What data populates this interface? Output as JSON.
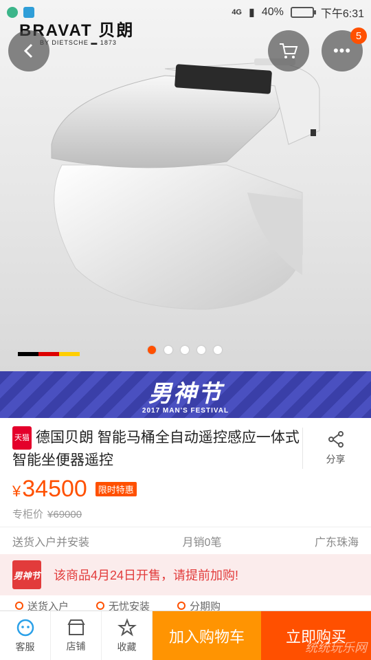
{
  "status": {
    "network": "4G",
    "battery": "40%",
    "battery_level": 0.4,
    "time": "下午6:31"
  },
  "hero": {
    "brand_name": "BRAVAT 贝朗",
    "brand_sub": "BY DIETSCHE ▬ 1873",
    "cart_badge": "5",
    "image_count": 5,
    "active_image": 1,
    "flag_colors": [
      "#000000",
      "#dd0000",
      "#ffce00"
    ]
  },
  "banner": {
    "title": "男神节",
    "subtitle": "2017 MAN'S FESTIVAL"
  },
  "product": {
    "store_tag": "天猫",
    "title": "德国贝朗 智能马桶全自动遥控感应一体式智能坐便器遥控",
    "share_label": "分享",
    "currency": "¥",
    "price": "34500",
    "promo_tag": "限时特惠",
    "orig_label": "专柜价",
    "orig_price": "¥69000"
  },
  "shipping": {
    "delivery": "送货入户并安装",
    "monthly_sales": "月销0笔",
    "location": "广东珠海"
  },
  "notice": {
    "logo_text": "男神节",
    "message": "该商品4月24日开售，请提前加购!"
  },
  "services": [
    "送货入户",
    "无忧安装",
    "分期购"
  ],
  "bottom": {
    "service_label": "客服",
    "store_label": "店铺",
    "fav_label": "收藏",
    "add_cart_label": "加入购物车",
    "buy_label": "立即购买",
    "watermark": "统统玩乐网"
  },
  "colors": {
    "accent": "#ff5000",
    "cart": "#ff9402",
    "notice": "#e23b3b"
  }
}
